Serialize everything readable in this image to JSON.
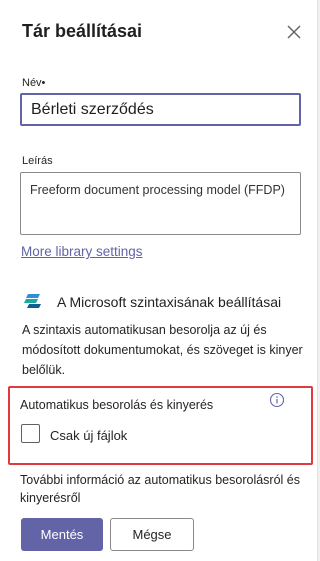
{
  "header": {
    "title": "Tár beállításai",
    "close_icon": "close-icon"
  },
  "name_field": {
    "label": "Név•",
    "value": "Bérleti szerződés"
  },
  "description_field": {
    "label": "Leírás",
    "value": "Freeform document processing model (FFDP)"
  },
  "links": {
    "more_settings": "More library settings"
  },
  "syntex": {
    "icon": "syntex-logo-icon",
    "title": "A Microsoft szintaxisának beállításai",
    "description": "A szintaxis automatikusan besorolja az új és módosított dokumentumokat, és szöveget is kinyer belőlük."
  },
  "auto_classification": {
    "label": "Automatikus besorolás és kinyerés",
    "info_icon": "info-icon",
    "checkbox_label": "Csak új fájlok",
    "checked": false,
    "highlight_color": "#e0393e"
  },
  "info_text": "További információ az automatikus besorolásról és kinyerésről",
  "buttons": {
    "save": "Mentés",
    "cancel": "Mégse"
  },
  "colors": {
    "accent": "#6264a7"
  }
}
